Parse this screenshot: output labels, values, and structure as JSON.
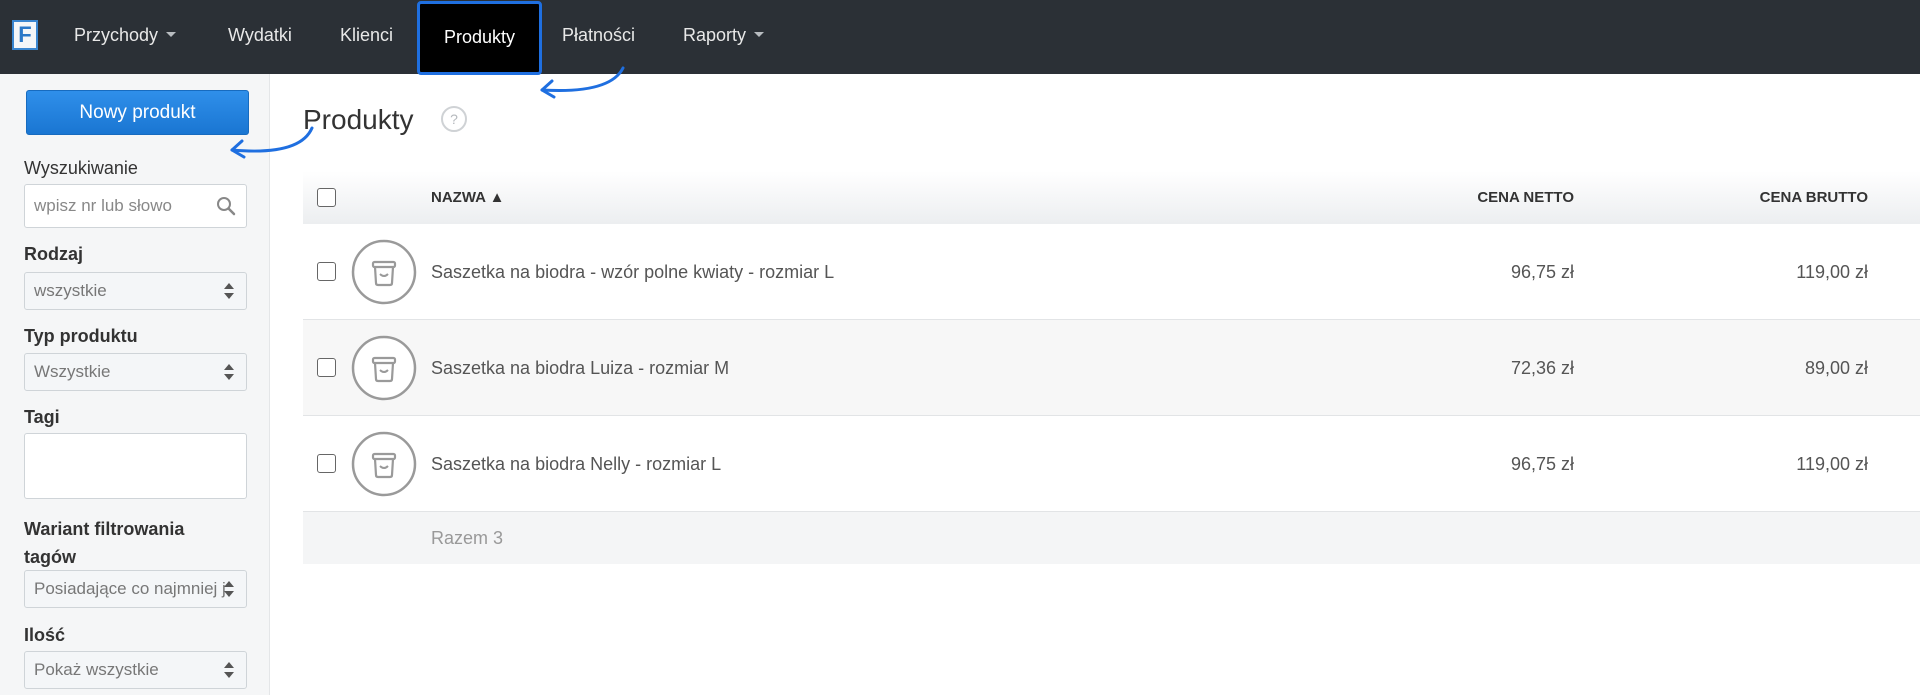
{
  "app": {
    "logo_letter": "F"
  },
  "nav": {
    "items": [
      {
        "label": "Przychody",
        "dropdown": true
      },
      {
        "label": "Wydatki"
      },
      {
        "label": "Klienci"
      },
      {
        "label": "Produkty",
        "active": true
      },
      {
        "label": "Płatności"
      },
      {
        "label": "Raporty",
        "dropdown": true
      }
    ]
  },
  "sidebar": {
    "new_button": "Nowy produkt",
    "search": {
      "label": "Wyszukiwanie",
      "placeholder": "wpisz nr lub słowo",
      "icon": "search-icon"
    },
    "kind": {
      "label": "Rodzaj",
      "value": "wszystkie"
    },
    "product_type": {
      "label": "Typ produktu",
      "value": "Wszystkie"
    },
    "tags": {
      "label": "Tagi",
      "value": ""
    },
    "tag_filter": {
      "label": "Wariant filtrowania tagów",
      "value": "Posiadające co najmniej j"
    },
    "quantity": {
      "label": "Ilość",
      "value": "Pokaż wszystkie"
    }
  },
  "main": {
    "title": "Produkty",
    "help": "?",
    "table": {
      "columns": {
        "name": "NAZWA ▲",
        "net": "CENA NETTO",
        "gross": "CENA BRUTTO"
      },
      "rows": [
        {
          "name": "Saszetka na biodra - wzór polne kwiaty - rozmiar L",
          "net": "96,75 zł",
          "gross": "119,00 zł"
        },
        {
          "name": "Saszetka na biodra Luiza - rozmiar M",
          "net": "72,36 zł",
          "gross": "89,00 zł"
        },
        {
          "name": "Saszetka na biodra Nelly - rozmiar L",
          "net": "96,75 zł",
          "gross": "119,00 zł"
        }
      ],
      "total": "Razem 3"
    }
  },
  "colors": {
    "nav_bg": "#2b3036",
    "accent": "#1f6fe0",
    "button": "#1a76d2",
    "annotation": "#1f6fe0"
  }
}
